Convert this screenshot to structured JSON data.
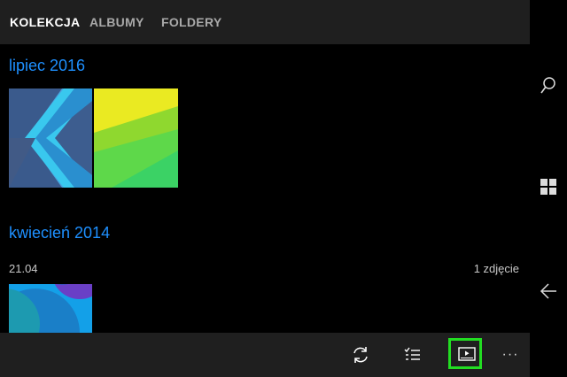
{
  "tabs": [
    {
      "label": "KOLEKCJA",
      "active": true
    },
    {
      "label": "ALBUMY",
      "active": false
    },
    {
      "label": "FOLDERY",
      "active": false
    }
  ],
  "groups": [
    {
      "title": "lipiec 2016"
    },
    {
      "title": "kwiecień 2014",
      "date": "21.04",
      "count": "1 zdjęcie"
    }
  ],
  "appbar": {
    "icons": [
      "sync-icon",
      "select-list-icon",
      "slideshow-icon",
      "more-icon"
    ],
    "more_label": "···",
    "highlight_color": "#22dd22"
  },
  "nav": {
    "icons": [
      "search-icon",
      "windows-start-icon",
      "back-icon"
    ]
  },
  "colors": {
    "accent": "#1e90ff",
    "bar_bg": "#1f1f1f",
    "background": "#000000"
  }
}
